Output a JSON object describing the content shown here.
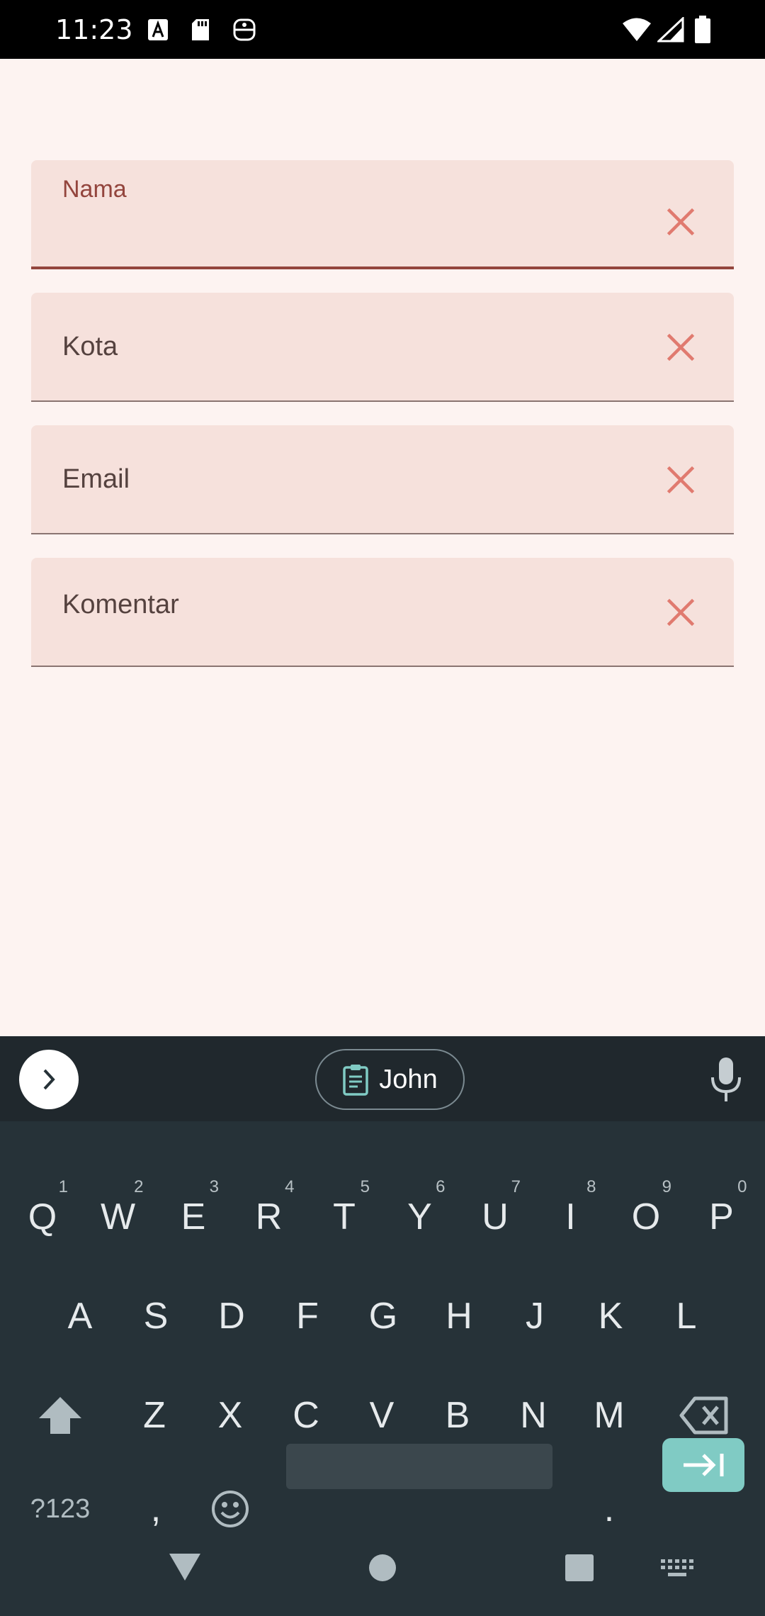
{
  "status_bar": {
    "time": "11:23",
    "icons": [
      "font-download-icon",
      "sd-card-icon",
      "accessibility-icon",
      "wifi-icon",
      "signal-icon",
      "battery-icon"
    ]
  },
  "form": {
    "fields": [
      {
        "label": "Nama",
        "value": "",
        "focused": true
      },
      {
        "label": "Kota",
        "value": ""
      },
      {
        "label": "Email",
        "value": ""
      },
      {
        "label": "Komentar",
        "value": ""
      }
    ],
    "clear_icon": "close-icon",
    "accent_color": "#93453d",
    "clear_color": "#e07a6f"
  },
  "keyboard": {
    "suggestion": "John",
    "row1": [
      "Q",
      "W",
      "E",
      "R",
      "T",
      "Y",
      "U",
      "I",
      "O",
      "P"
    ],
    "row1_hints": [
      "1",
      "2",
      "3",
      "4",
      "5",
      "6",
      "7",
      "8",
      "9",
      "0"
    ],
    "row2": [
      "A",
      "S",
      "D",
      "F",
      "G",
      "H",
      "J",
      "K",
      "L"
    ],
    "row3": [
      "Z",
      "X",
      "C",
      "V",
      "B",
      "N",
      "M"
    ],
    "symbols_key": "?123",
    "comma_key": ",",
    "period_key": ".",
    "accent_color": "#80cbc4"
  }
}
